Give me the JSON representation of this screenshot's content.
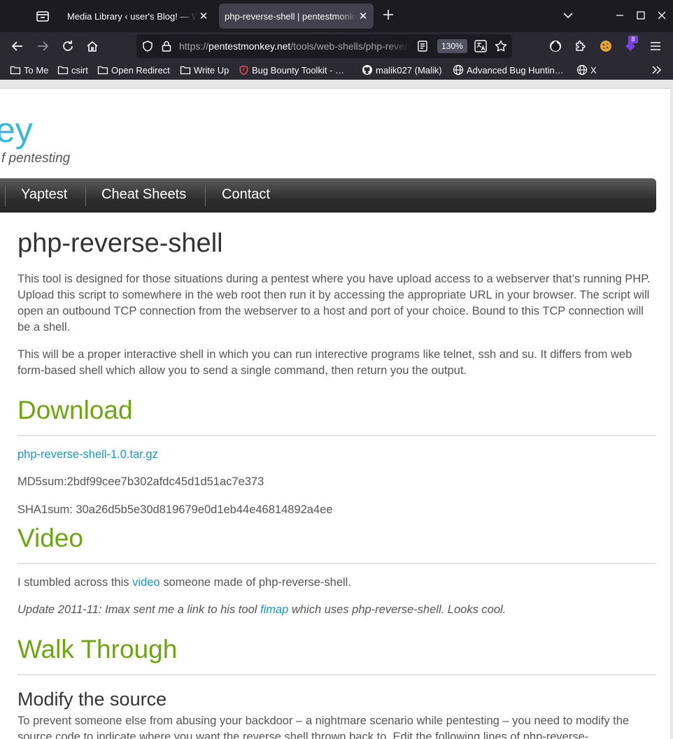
{
  "browser": {
    "tabs": [
      {
        "title": "Media Library ‹ user's Blog! — WordPress",
        "active": false
      },
      {
        "title": "php-reverse-shell | pentestmonkey",
        "active": true
      }
    ],
    "url": {
      "scheme": "https://",
      "host": "pentestmonkey.net",
      "path": "/tools/web-shells/php-reverse-shell"
    },
    "zoom": "130%",
    "extension_badge": "8",
    "bookmarks": [
      {
        "label": "To Me",
        "icon": "folder-icon"
      },
      {
        "label": "csirt",
        "icon": "folder-icon"
      },
      {
        "label": "Open Redirect",
        "icon": "folder-icon"
      },
      {
        "label": "Write Up",
        "icon": "folder-icon"
      },
      {
        "label": "Bug Bounty Toolkit - …",
        "icon": "shield-icon"
      },
      {
        "label": "malik027 (Malik)",
        "icon": "github-icon"
      },
      {
        "label": "Advanced Bug Huntin…",
        "icon": "globe-icon"
      },
      {
        "label": "X",
        "icon": "globe-icon"
      }
    ]
  },
  "site": {
    "title_fragment": "ey",
    "description_fragment": "f pentesting",
    "menu": [
      "Yaptest",
      "Cheat Sheets",
      "Contact"
    ]
  },
  "article": {
    "title": "php-reverse-shell",
    "intro_1": "This tool is designed for those situations during a pentest where you have upload access to a webserver that’s running PHP.  Upload this script to somewhere in the web root then run it by accessing the appropriate URL in your browser.  The script will open an outbound TCP connection from the webserver to a host and port of your choice.  Bound to this TCP connection will be a shell.",
    "intro_2": "This will be a proper interactive shell in which you can run interective programs like telnet, ssh and su.  It differs from web form-based shell which allow you to send a single command, then return you the output.",
    "download": {
      "heading": "Download",
      "file_link": "php-reverse-shell-1.0.tar.gz",
      "md5": "MD5sum:2bdf99cee7b302afdc45d1d51ac7e373",
      "sha1": "SHA1sum: 30a26d5b5e30d819679e0d1eb44e46814892a4ee"
    },
    "video": {
      "heading": "Video",
      "text_before": "I stumbled across this ",
      "link": "video",
      "text_after": " someone made of php-reverse-shell.",
      "update_before": "Update 2011-11: Imax sent me a link to his tool ",
      "update_link": "fimap",
      "update_after": " which uses php-reverse-shell.  Looks cool."
    },
    "walkthrough": {
      "heading": "Walk Through",
      "subheading": "Modify the source",
      "text": "To prevent someone else from abusing your backdoor – a nightmare scenario while pentesting – you need to modify the source code to indicate where you want the reverse shell thrown back to.  Edit the following lines of php-reverse-"
    }
  }
}
